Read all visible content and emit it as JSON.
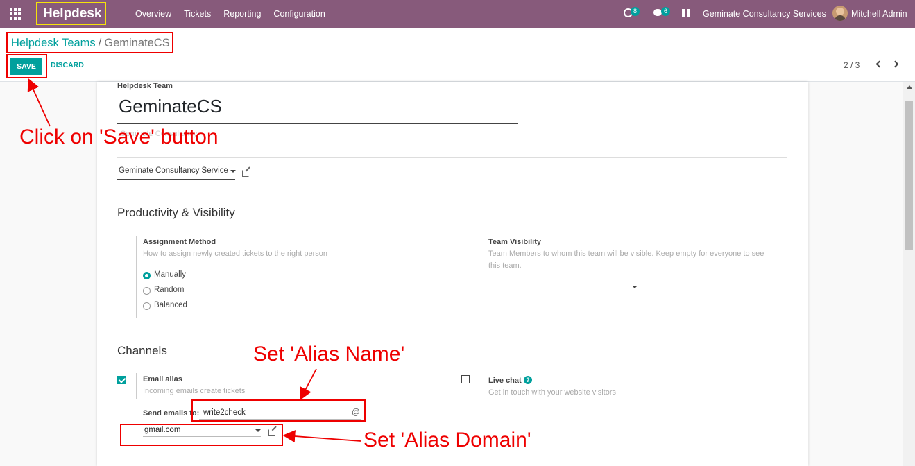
{
  "topbar": {
    "app_name": "Helpdesk",
    "menu": [
      "Overview",
      "Tickets",
      "Reporting",
      "Configuration"
    ],
    "activity_count": "8",
    "message_count": "6",
    "company": "Geminate Consultancy Services",
    "user": "Mitchell Admin"
  },
  "control": {
    "breadcrumb_parent": "Helpdesk Teams",
    "breadcrumb_sep": "/",
    "breadcrumb_current": "GeminateCS",
    "save_label": "SAVE",
    "discard_label": "DISCARD",
    "pager": "2 / 3"
  },
  "form": {
    "team_label": "Helpdesk Team",
    "team_name": "GeminateCS",
    "team_sub_placeholder": "Geminate Consultancy",
    "company_value": "Geminate Consultancy Service",
    "productivity_title": "Productivity & Visibility",
    "assignment_label": "Assignment Method",
    "assignment_help": "How to assign newly created tickets to the right person",
    "assignment_options": [
      "Manually",
      "Random",
      "Balanced"
    ],
    "visibility_label": "Team Visibility",
    "visibility_help_1": "Team Members to whom this team will be visible. Keep empty for everyone to see",
    "visibility_help_2": "this team.",
    "channels_title": "Channels",
    "email_alias_label": "Email alias",
    "email_alias_help": "Incoming emails create tickets",
    "send_emails_label": "Send emails to:",
    "alias_name": "write2check",
    "alias_at": "@",
    "alias_domain": "gmail.com",
    "live_chat_label": "Live chat",
    "live_chat_help": "Get in touch with your website visitors"
  },
  "annotations": {
    "save": "Click on 'Save' button",
    "alias_name": "Set 'Alias Name'",
    "alias_domain": "Set 'Alias Domain'"
  },
  "colors": {
    "navbar": "#875a7b",
    "accent": "#00a09d",
    "annotation": "#e00000"
  }
}
